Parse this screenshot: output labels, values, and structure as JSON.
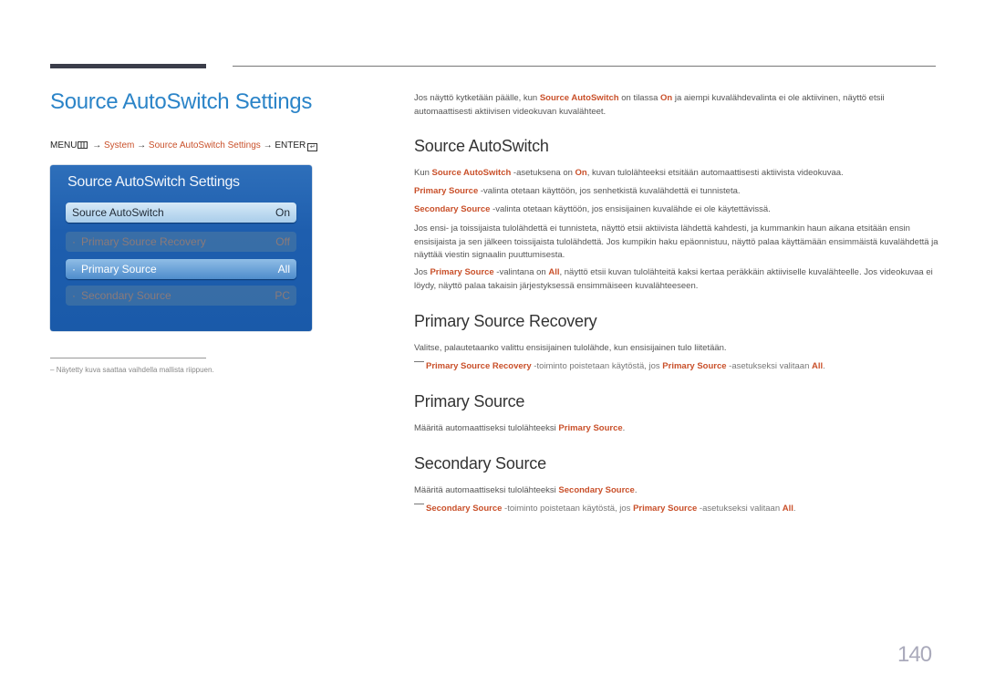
{
  "page_title": "Source AutoSwitch Settings",
  "breadcrumb": {
    "menu": "MENU",
    "arrow": "→",
    "system": "System",
    "settings": "Source AutoSwitch Settings",
    "enter": "ENTER",
    "enter_symbol": "↵"
  },
  "osd": {
    "title": "Source AutoSwitch Settings",
    "rows": [
      {
        "label": "Source AutoSwitch",
        "value": "On",
        "state": "selected",
        "bullet": ""
      },
      {
        "label": "Primary Source Recovery",
        "value": "Off",
        "state": "disabled",
        "bullet": "·"
      },
      {
        "label": "Primary Source",
        "value": "All",
        "state": "active",
        "bullet": "·"
      },
      {
        "label": "Secondary Source",
        "value": "PC",
        "state": "disabled",
        "bullet": "·"
      }
    ]
  },
  "footnote": {
    "dash": "–",
    "text": "Näytetty kuva saattaa vaihdella mallista riippuen."
  },
  "intro": {
    "t1": "Jos näyttö kytketään päälle, kun ",
    "h1": "Source AutoSwitch",
    "t2": " on tilassa ",
    "h2": "On",
    "t3": " ja aiempi kuvalähdevalinta ei ole aktiivinen, näyttö etsii automaattisesti aktiivisen videokuvan kuvalähteet."
  },
  "sections": {
    "autoswitch": {
      "heading": "Source AutoSwitch",
      "p1": {
        "t1": "Kun ",
        "h1": "Source AutoSwitch",
        "t2": " -asetuksena on ",
        "h2": "On",
        "t3": ", kuvan tulolähteeksi etsitään automaattisesti aktiivista videokuvaa."
      },
      "p2": {
        "h1": "Primary Source",
        "t1": " -valinta otetaan käyttöön, jos senhetkistä kuvalähdettä ei tunnisteta."
      },
      "p3": {
        "h1": "Secondary Source",
        "t1": " -valinta otetaan käyttöön, jos ensisijainen kuvalähde ei ole käytettävissä."
      },
      "p4": "Jos ensi- ja toissijaista tulolähdettä ei tunnisteta, näyttö etsii aktiivista lähdettä kahdesti, ja kummankin haun aikana etsitään ensin ensisijaista ja sen jälkeen toissijaista tulolähdettä. Jos kumpikin haku epäonnistuu, näyttö palaa käyttämään ensimmäistä kuvalähdettä ja näyttää viestin signaalin puuttumisesta.",
      "p5": {
        "t1": "Jos ",
        "h1": "Primary Source",
        "t2": " -valintana on ",
        "h2": "All",
        "t3": ", näyttö etsii kuvan tulolähteitä kaksi kertaa peräkkäin aktiiviselle kuvalähteelle. Jos videokuvaa ei löydy, näyttö palaa takaisin järjestyksessä ensimmäiseen kuvalähteeseen."
      }
    },
    "recovery": {
      "heading": "Primary Source Recovery",
      "p1": "Valitse, palautetaanko valittu ensisijainen tulolähde, kun ensisijainen tulo liitetään.",
      "note": {
        "h1": "Primary Source Recovery",
        "t1": " -toiminto poistetaan käytöstä, jos ",
        "h2": "Primary Source",
        "t2": " -asetukseksi valitaan ",
        "h3": "All",
        "t3": "."
      }
    },
    "primary": {
      "heading": "Primary Source",
      "p1": {
        "t1": "Määritä automaattiseksi tulolähteeksi ",
        "h1": "Primary Source",
        "t2": "."
      }
    },
    "secondary": {
      "heading": "Secondary Source",
      "p1": {
        "t1": "Määritä automaattiseksi tulolähteeksi ",
        "h1": "Secondary Source",
        "t2": "."
      },
      "note": {
        "h1": "Secondary Source",
        "t1": " -toiminto poistetaan käytöstä, jos ",
        "h2": "Primary Source",
        "t2": " -asetukseksi valitaan ",
        "h3": "All",
        "t3": "."
      }
    }
  },
  "page_number": "140",
  "colors": {
    "title_blue": "#2b84c8",
    "highlight_orange": "#c9502a",
    "osd_blue": "#1e5eae"
  }
}
